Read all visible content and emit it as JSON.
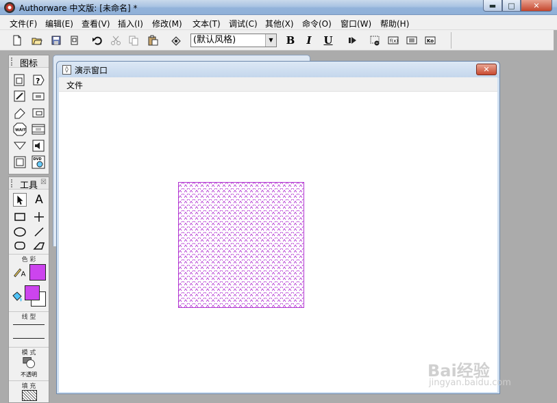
{
  "window": {
    "title": "Authorware 中文版: [未命名] *"
  },
  "menubar": {
    "items": [
      "文件(F)",
      "编辑(E)",
      "查看(V)",
      "插入(I)",
      "修改(M)",
      "文本(T)",
      "调试(C)",
      "其他(X)",
      "命令(O)",
      "窗口(W)",
      "帮助(H)"
    ]
  },
  "toolbar": {
    "style_value": "(默认风格)",
    "bold_label": "B",
    "italic_label": "I",
    "underline_label": "U"
  },
  "icons_palette": {
    "title": "图标"
  },
  "tools_palette": {
    "title": "工具",
    "color_label": "色 彩",
    "line_label": "线 型",
    "mode_label": "模 式",
    "mode_value": "不透明",
    "fill_label": "填 充",
    "text_tool_label": "A",
    "colors": {
      "line_text": "#cc44ee",
      "fill_fore": "#cc44ee",
      "fill_back": "#ffffff"
    }
  },
  "presentation_window": {
    "title": "演示窗口",
    "menu_file": "文件"
  },
  "canvas": {
    "shape": "square",
    "pattern_color": "#b030d0"
  },
  "watermark": {
    "main": "Bai经验",
    "sub": "jingyan.baidu.com"
  }
}
